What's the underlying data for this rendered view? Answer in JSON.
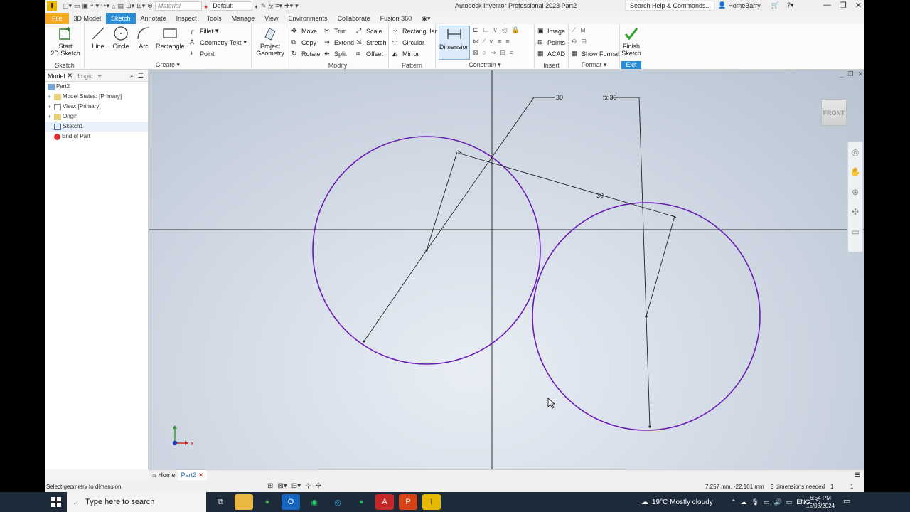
{
  "titlebar": {
    "app_letter": "I",
    "material_placeholder": "Material",
    "appearance": "Default",
    "title": "Autodesk Inventor Professional 2023    Part2",
    "search": "Search Help & Commands...",
    "user": "HomeBarry"
  },
  "tabs": [
    "File",
    "3D Model",
    "Sketch",
    "Annotate",
    "Inspect",
    "Tools",
    "Manage",
    "View",
    "Environments",
    "Collaborate",
    "Fusion 360"
  ],
  "ribbon": {
    "sketch_panel": {
      "start": "Start",
      "start2": "2D Sketch",
      "label": "Sketch"
    },
    "create_panel": {
      "line": "Line",
      "circle": "Circle",
      "arc": "Arc",
      "rectangle": "Rectangle",
      "fillet": "Fillet",
      "geometry_text": "Geometry Text",
      "point": "Point",
      "label": "Create"
    },
    "project_panel": {
      "l1": "Project",
      "l2": "Geometry"
    },
    "modify_panel": {
      "move": "Move",
      "trim": "Trim",
      "scale": "Scale",
      "copy": "Copy",
      "extend": "Extend",
      "stretch": "Stretch",
      "rotate": "Rotate",
      "split": "Split",
      "offset": "Offset",
      "label": "Modify"
    },
    "pattern_panel": {
      "rectangular": "Rectangular",
      "circular": "Circular",
      "mirror": "Mirror",
      "label": "Pattern"
    },
    "constrain_panel": {
      "dimension": "Dimension",
      "label": "Constrain"
    },
    "insert_panel": {
      "image": "Image",
      "points": "Points",
      "acad": "ACAD",
      "label": "Insert"
    },
    "format_panel": {
      "show_format": "Show Format",
      "label": "Format"
    },
    "exit_panel": {
      "finish1": "Finish",
      "finish2": "Sketch",
      "label": "Exit"
    }
  },
  "browser": {
    "tab_model": "Model",
    "tab_logic": "Logic",
    "items": [
      {
        "label": "Part2"
      },
      {
        "label": "Model States: [Primary]"
      },
      {
        "label": "View: [Primary]"
      },
      {
        "label": "Origin"
      },
      {
        "label": "Sketch1"
      },
      {
        "label": "End of Part"
      }
    ]
  },
  "canvas": {
    "viewcube": "FRONT",
    "dim_top": "30",
    "dim_fx": "fx:30",
    "dim_mid": "30",
    "triad_x": "x"
  },
  "doctabs": {
    "home": "Home",
    "part": "Part2"
  },
  "status": {
    "message": "Select geometry to dimension",
    "coords": "7.257 mm, -22.101 mm",
    "dims_needed": "3 dimensions needed",
    "count1": "1",
    "count2": "1"
  },
  "taskbar": {
    "search_placeholder": "Type here to search",
    "weather": "19°C  Mostly cloudy",
    "lang": "ENG",
    "time": "6:54 PM",
    "date": "15/03/2024"
  },
  "colors": {
    "accent": "#2b8dd6",
    "file_tab": "#f5a623",
    "sketch_curve": "#6a1bb5"
  }
}
